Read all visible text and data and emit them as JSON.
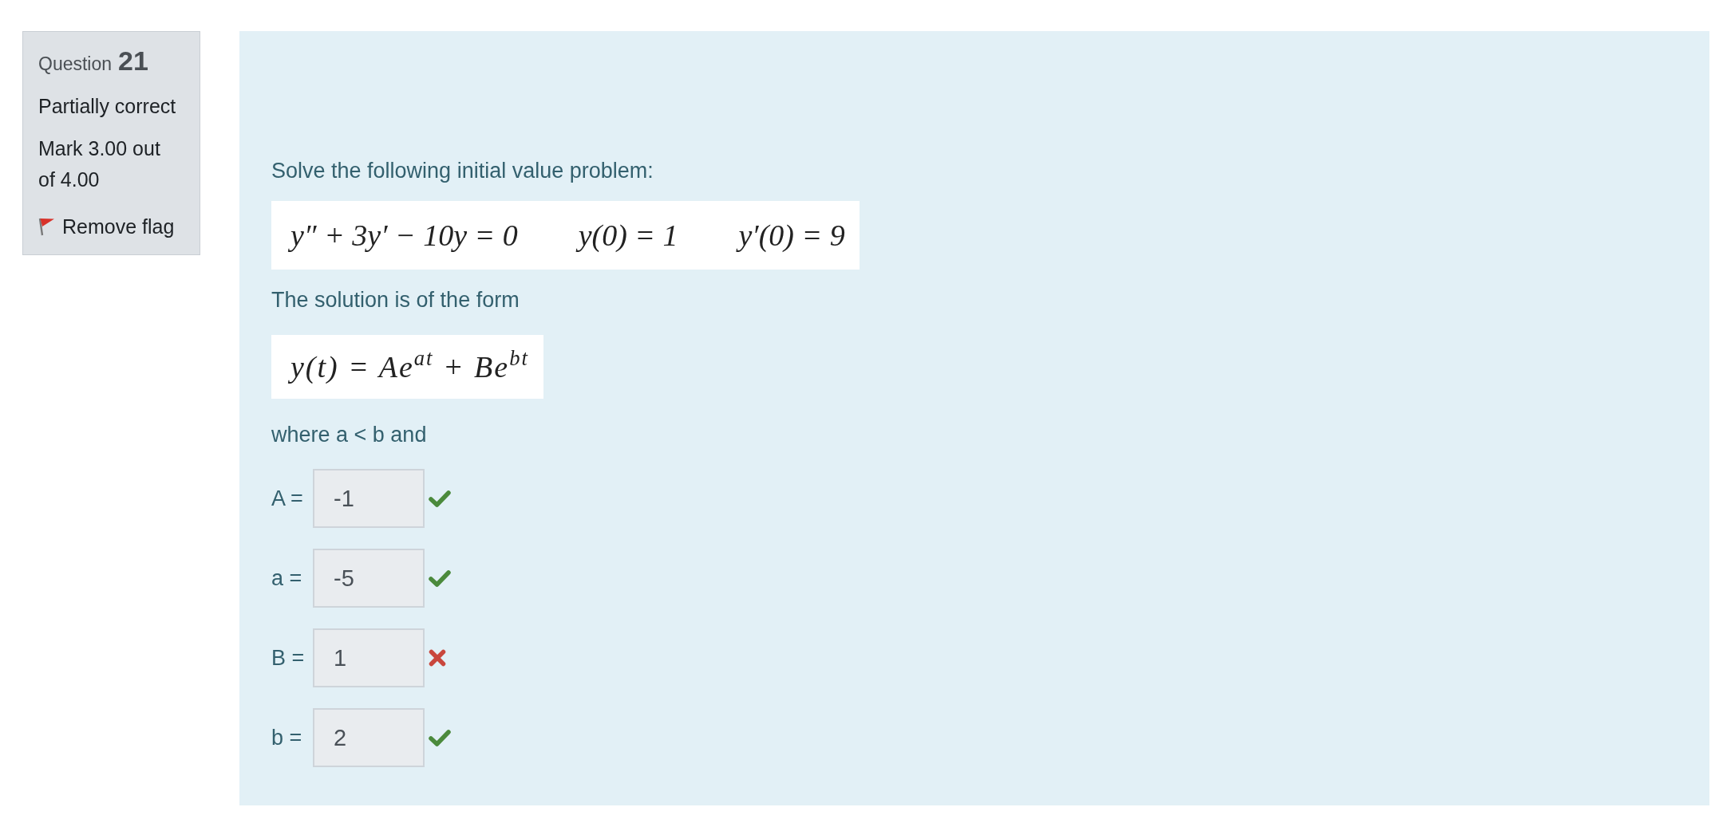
{
  "question_info": {
    "label": "Question",
    "number": "21",
    "state": "Partially correct",
    "grade": "Mark 3.00 out of 4.00",
    "flag": {
      "label": "Remove flag",
      "flagged": true
    }
  },
  "question": {
    "prompt": "Solve the following initial value problem:",
    "equation": [
      "y″ + 3y′ − 10y = 0",
      "y(0) = 1",
      "y′(0) = 9"
    ],
    "form_intro": "The solution is of the form",
    "form": "y(t) = Ae$^{at}$ + Be$^{bt}$",
    "condition": "where a < b and",
    "answers": [
      {
        "label": "A =",
        "value": "-1",
        "correct": true
      },
      {
        "label": "a =",
        "value": "-5",
        "correct": true
      },
      {
        "label": "B =",
        "value": "1",
        "correct": false
      },
      {
        "label": "b =",
        "value": "2",
        "correct": true
      }
    ]
  }
}
